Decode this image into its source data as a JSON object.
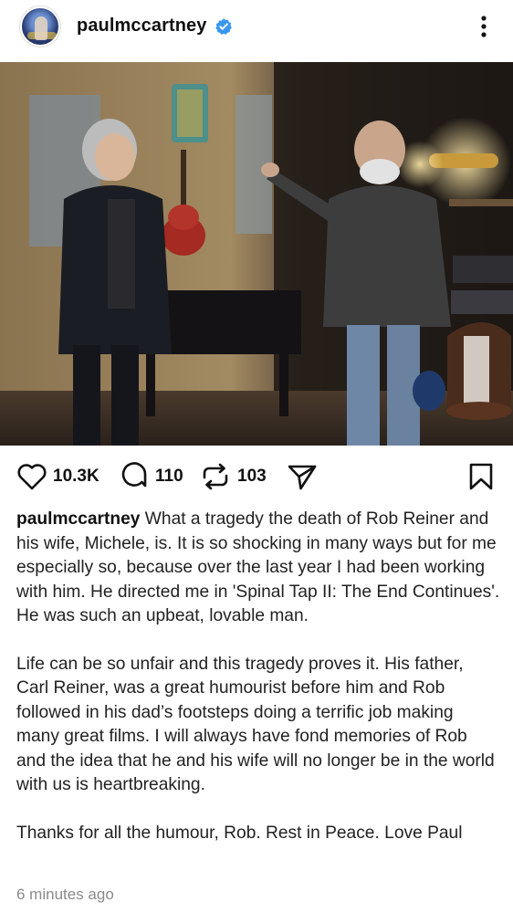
{
  "post": {
    "username": "paulmccartney",
    "verified": true,
    "likes": "10.3K",
    "comments": "110",
    "reposts": "103",
    "caption_user": "paulmccartney",
    "caption_p1": "What a tragedy the death of Rob Reiner and his wife, Michele, is. It is so shocking in many ways but for me especially so, because over the last year I had been working with him. He directed me in 'Spinal Tap II: The End Continues'. He was such an upbeat, lovable man.",
    "caption_p2": "Life can be so unfair and this tragedy proves it. His father, Carl Reiner, was a great humourist before him and Rob followed in his dad’s footsteps doing a terrific job making many great films. I will always have fond memories of Rob and the idea that he and his wife will no longer be in the world with us is heartbreaking.",
    "caption_p3": "Thanks for all the humour, Rob. Rest in Peace. Love Paul",
    "timestamp": "6 minutes ago"
  },
  "icons": {
    "avatar": "avatar",
    "verified": "verified-badge-icon",
    "more": "more-options-icon",
    "like": "heart-icon",
    "comment": "comment-icon",
    "repost": "repost-icon",
    "share": "share-icon",
    "save": "bookmark-icon"
  },
  "colors": {
    "verified_blue": "#3897f0",
    "text": "#111111",
    "muted": "#8a8a8a"
  }
}
